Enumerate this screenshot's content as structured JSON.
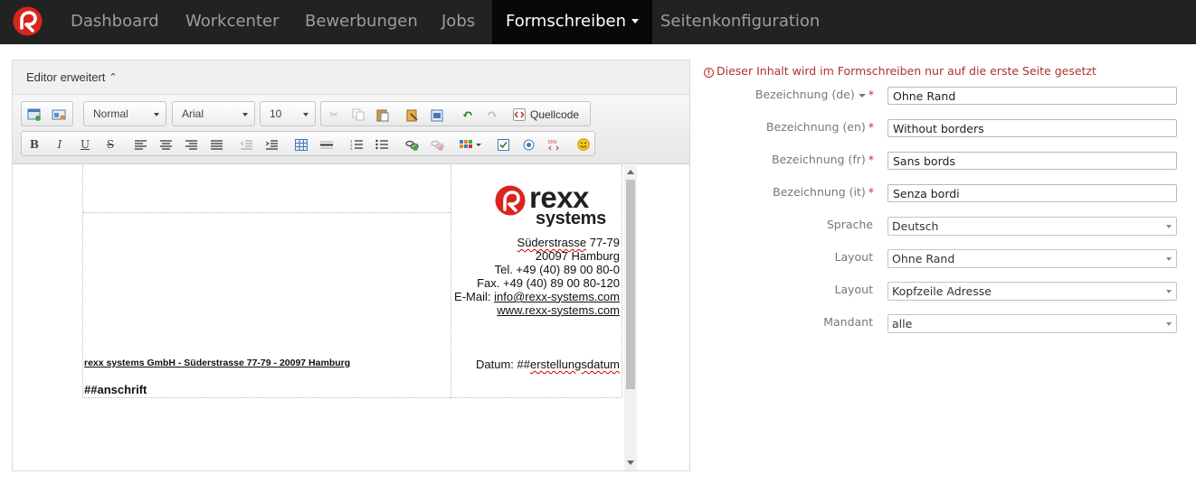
{
  "nav": {
    "items": [
      "Dashboard",
      "Workcenter",
      "Bewerbungen",
      "Jobs",
      "Formschreiben",
      "Seitenkonfiguration"
    ],
    "active": "Formschreiben"
  },
  "editor": {
    "title": "Editor erweitert",
    "toolbar": {
      "format": "Normal",
      "font": "Arial",
      "size": "10",
      "source_label": "Quellcode",
      "source_icon": "source-code-icon"
    },
    "document": {
      "logo_text_1": "rexx",
      "logo_text_2": "systems",
      "street_name": "Süderstrasse",
      "street_no": " 77-79",
      "city": "20097 Hamburg",
      "tel": "Tel. +49 (40) 89 00 80-0",
      "fax": "Fax. +49 (40) 89 00 80-120",
      "email_prefix": "E-Mail: ",
      "email": "info@rexx-systems.com",
      "web": "www.rexx-systems.com",
      "sender_line": "rexx systems GmbH - Süderstrasse 77-79 - 20097 Hamburg",
      "date_prefix": "Datum: ##",
      "date_field": "erstellungsdatum",
      "anschrift": "##anschrift"
    }
  },
  "form": {
    "notice": "Dieser Inhalt wird im Formschreiben nur auf die erste Seite gesetzt",
    "fields": {
      "name_de": {
        "label": "Bezeichnung (de)",
        "value": "Ohne Rand"
      },
      "name_en": {
        "label": "Bezeichnung (en)",
        "value": "Without borders"
      },
      "name_fr": {
        "label": "Bezeichnung (fr)",
        "value": "Sans bords"
      },
      "name_it": {
        "label": "Bezeichnung (it)",
        "value": "Senza bordi"
      },
      "sprache": {
        "label": "Sprache",
        "value": "Deutsch"
      },
      "layout1": {
        "label": "Layout",
        "value": "Ohne Rand"
      },
      "layout2": {
        "label": "Layout",
        "value": "Kopfzeile Adresse"
      },
      "mandant": {
        "label": "Mandant",
        "value": "alle"
      }
    },
    "required_mark": "*"
  },
  "colors": {
    "navbar": "#222222",
    "nav_active": "#080808",
    "brand_red": "#d9251d",
    "notice": "#b03030",
    "required": "#c9302c"
  }
}
